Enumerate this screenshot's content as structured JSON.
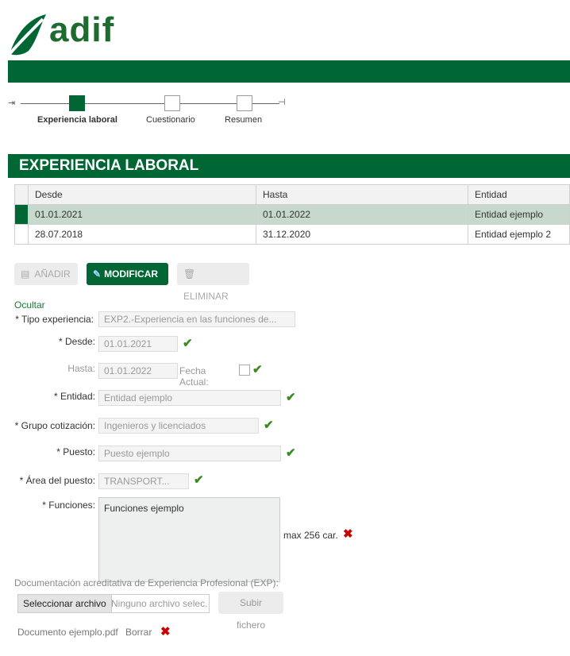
{
  "brand": {
    "name": "adif",
    "color": "#006633"
  },
  "steps": [
    {
      "label": "Experiencia laboral",
      "active": true
    },
    {
      "label": "Cuestionario",
      "active": false
    },
    {
      "label": "Resumen",
      "active": false
    }
  ],
  "section": {
    "title": "EXPERIENCIA LABORAL"
  },
  "table": {
    "headers": [
      "Desde",
      "Hasta",
      "Entidad"
    ],
    "rows": [
      {
        "desde": "01.01.2021",
        "hasta": "01.01.2022",
        "entidad": "Entidad ejemplo",
        "selected": true
      },
      {
        "desde": "28.07.2018",
        "hasta": "31.12.2020",
        "entidad": "Entidad ejemplo 2",
        "selected": false
      }
    ]
  },
  "toolbar": {
    "add_label": "AÑADIR",
    "modify_label": "MODIFICAR",
    "delete_label": "ELIMINAR"
  },
  "form": {
    "toggle_label": "Ocultar",
    "tipo_label": "* Tipo experiencia:",
    "tipo_value": "EXP2.-Experiencia en las funciones de...",
    "desde_label": "* Desde:",
    "desde_value": "01.01.2021",
    "hasta_label": "Hasta:",
    "hasta_value": "01.01.2022",
    "fecha_actual_label": "Fecha Actual:",
    "entidad_label": "* Entidad:",
    "entidad_value": "Entidad ejemplo",
    "grupo_label": "* Grupo cotización:",
    "grupo_value": "Ingenieros y licenciados",
    "puesto_label": "* Puesto:",
    "puesto_value": "Puesto ejemplo",
    "area_label": "* Área del puesto:",
    "area_value": "TRANSPORT...",
    "funciones_label": "* Funciones:",
    "funciones_value": "Funciones ejemplo",
    "max_label": "max 256 car."
  },
  "docs": {
    "title": "Documentación acreditativa de Experiencia Profesional (EXP):",
    "select_label": "Seleccionar archivo",
    "no_file_label": "Ninguno archivo selec.",
    "upload_label": "Subir fichero",
    "file_name": "Documento ejemplo.pdf",
    "delete_label": "Borrar"
  }
}
